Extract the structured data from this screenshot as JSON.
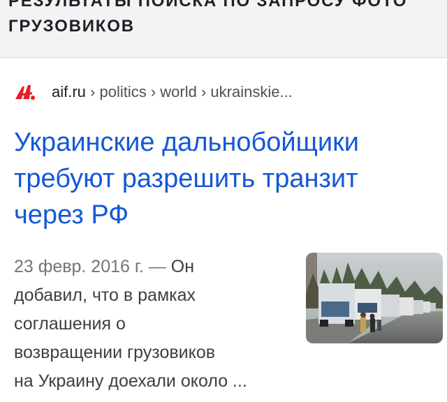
{
  "header": {
    "line1": "РЕЗУЛЬТАТЫ ПОИСКА ПО ЗАПРОСУ ФОТО",
    "line2": "ГРУЗОВИКОВ"
  },
  "result": {
    "favicon": "aif-logo-icon",
    "domain": "aif.ru",
    "breadcrumb": " › politics › world › ukrainskie...",
    "title_lines": [
      "Украинские дальнобойщики",
      "требуют разрешить транзит",
      "через РФ"
    ],
    "date": "23 февр. 2016 г. — ",
    "snippet_lines": [
      "Он",
      "добавил, что в рамках",
      "соглашения о",
      "возвращении грузовиков",
      "на Украину доехали около ..."
    ],
    "thumbnail": "truck-convoy-photo"
  },
  "colors": {
    "title": "#1558d6",
    "favicon": "#e41e26",
    "header_bg": "#f1f3f4"
  }
}
